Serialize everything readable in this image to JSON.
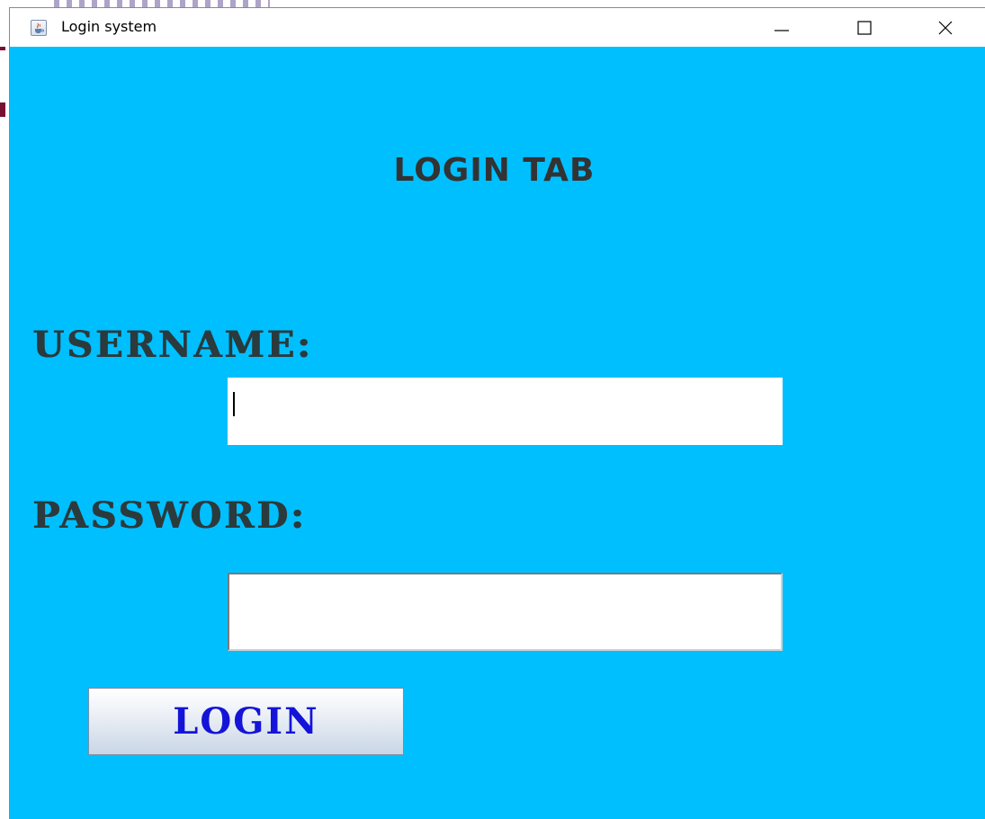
{
  "window": {
    "title": "Login system",
    "app_icon": "java-cup-icon",
    "controls": {
      "minimize_icon": "minimize-icon",
      "maximize_icon": "maximize-icon",
      "close_icon": "close-icon"
    }
  },
  "form": {
    "heading": "LOGIN TAB",
    "username_label": "USERNAME:",
    "username_value": "",
    "password_label": "PASSWORD:",
    "password_value": "",
    "login_button_label": "LOGIN"
  },
  "colors": {
    "background": "#00bfff",
    "label_text": "#2b3a3c",
    "button_text": "#1414d8"
  }
}
